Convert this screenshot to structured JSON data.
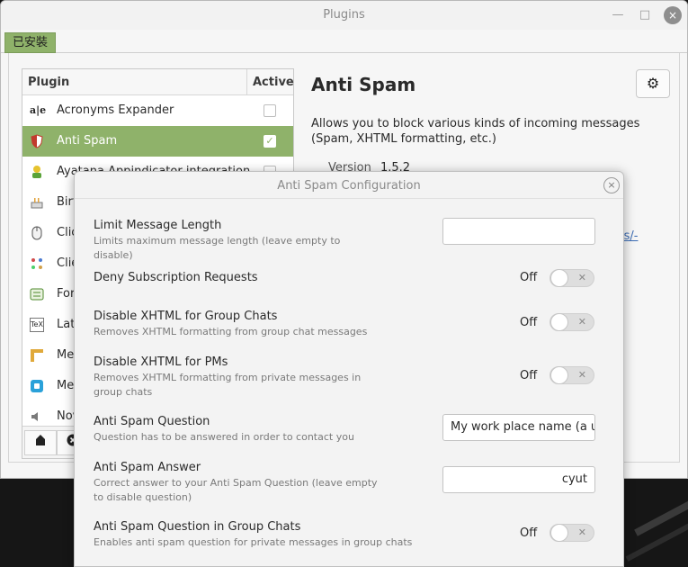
{
  "window": {
    "title": "Plugins",
    "minimize_glyph": "—",
    "maximize_glyph": "□",
    "close_glyph": "×"
  },
  "tabs": {
    "installed": "已安裝"
  },
  "plugin_list": {
    "col_plugin": "Plugin",
    "col_active": "Active",
    "items": [
      {
        "name": "Acronyms Expander",
        "icon": "acronyms-icon",
        "active": false
      },
      {
        "name": "Anti Spam",
        "icon": "shield-icon",
        "active": true
      },
      {
        "name": "Ayatana Appindicator integration",
        "icon": "appindicator-icon",
        "active": false
      },
      {
        "name": "Birt",
        "icon": "birthday-cake-icon",
        "active": null
      },
      {
        "name": "Clic",
        "icon": "mouse-icon",
        "active": null
      },
      {
        "name": "Clie",
        "icon": "dots-grid-icon",
        "active": null
      },
      {
        "name": "For",
        "icon": "form-icon",
        "active": null
      },
      {
        "name": "Lat",
        "icon": "tex-icon",
        "active": null
      },
      {
        "name": "Me",
        "icon": "message-icon",
        "active": null
      },
      {
        "name": "Me",
        "icon": "twitter-icon",
        "active": null
      },
      {
        "name": "Nov",
        "icon": "speaker-icon",
        "active": null
      }
    ],
    "toolbar": [
      "install-icon",
      "remove-icon"
    ]
  },
  "detail": {
    "title": "Anti Spam",
    "description": "Allows you to block various kinds of incoming messages (Spam, XHTML formatting, etc.)",
    "version_label": "Version",
    "version_value": "1.5.2",
    "homepage_fragment": "is/-",
    "settings_icon": "gear-icon"
  },
  "dialog": {
    "title": "Anti Spam Configuration",
    "close_glyph": "×",
    "settings": [
      {
        "label": "Limit Message Length",
        "description": "Limits maximum message length (leave empty to disable)",
        "type": "text",
        "value": ""
      },
      {
        "label": "Deny Subscription Requests",
        "description": "",
        "type": "toggle",
        "state": "Off"
      },
      {
        "label": "Disable XHTML for Group Chats",
        "description": "Removes XHTML formatting from group chat messages",
        "type": "toggle",
        "state": "Off"
      },
      {
        "label": "Disable XHTML for PMs",
        "description": "Removes XHTML formatting from private messages in group chats",
        "type": "toggle",
        "state": "Off"
      },
      {
        "label": "Anti Spam Question",
        "description": "Question has to be answered in order to contact you",
        "type": "text",
        "value": "My work place name (a ur"
      },
      {
        "label": "Anti Spam Answer",
        "description": "Correct answer to your Anti Spam Question (leave empty to disable question)",
        "type": "text",
        "value": "cyut"
      },
      {
        "label": "Anti Spam Question in Group Chats",
        "description": "Enables anti spam question for private messages in group chats",
        "type": "toggle",
        "state": "Off"
      }
    ]
  },
  "colors": {
    "accent_green": "#8fb26a",
    "link_blue": "#3c6db5"
  }
}
